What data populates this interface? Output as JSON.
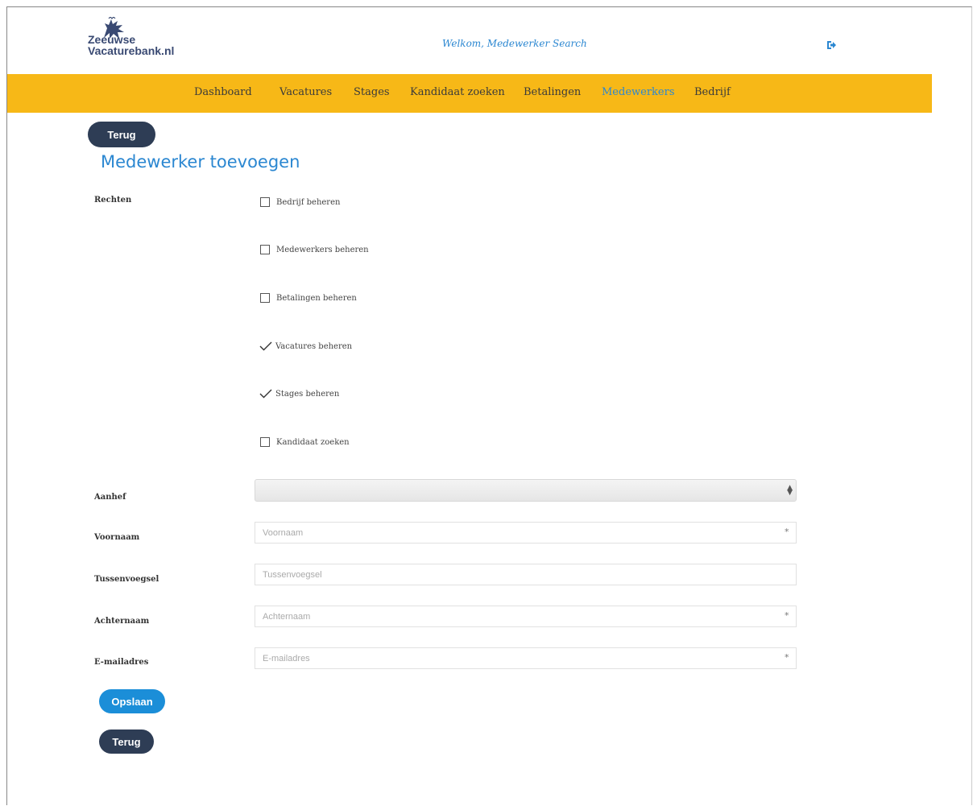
{
  "header": {
    "logo_line1": "Zeeuwse",
    "logo_line2": "Vacaturebank.nl",
    "welcome": "Welkom, Medewerker Search"
  },
  "nav": {
    "items": [
      "Dashboard",
      "Vacatures",
      "Stages",
      "Kandidaat zoeken",
      "Betalingen",
      "Medewerkers",
      "Bedrijf"
    ],
    "active": "Medewerkers"
  },
  "buttons": {
    "back_top": "Terug",
    "save": "Opslaan",
    "back_bottom": "Terug"
  },
  "page": {
    "title": "Medewerker toevoegen"
  },
  "form": {
    "rights_label": "Rechten",
    "permissions": [
      {
        "label": "Bedrijf beheren",
        "checked": false
      },
      {
        "label": "Medewerkers beheren",
        "checked": false
      },
      {
        "label": "Betalingen beheren",
        "checked": false
      },
      {
        "label": "Vacatures beheren",
        "checked": true
      },
      {
        "label": "Stages beheren",
        "checked": true
      },
      {
        "label": "Kandidaat zoeken",
        "checked": false
      }
    ],
    "salutation_label": "Aanhef",
    "salutation_value": "",
    "firstname_label": "Voornaam",
    "firstname_placeholder": "Voornaam",
    "infix_label": "Tussenvoegsel",
    "infix_placeholder": "Tussenvoegsel",
    "lastname_label": "Achternaam",
    "lastname_placeholder": "Achternaam",
    "email_label": "E-mailadres",
    "email_placeholder": "E-mailadres",
    "required_marker": "*"
  },
  "colors": {
    "nav_bg": "#f7b817",
    "accent_blue": "#2b87d1",
    "button_dark": "#2e3d55",
    "button_blue": "#1b8ed8"
  }
}
